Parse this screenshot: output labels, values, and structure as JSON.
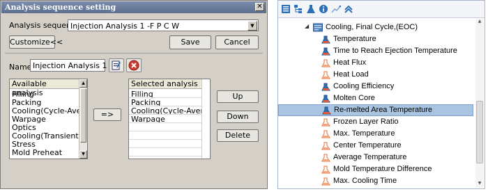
{
  "dialog": {
    "title": "Analysis sequence setting",
    "close_glyph": "✕",
    "sequence_label": "Analysis sequence:",
    "sequence_value": "Injection Analysis 1 -F P C W",
    "customize_label": "Customize<<",
    "save_label": "Save",
    "cancel_label": "Cancel",
    "name_label": "Name:",
    "name_value": "Injection Analysis 1",
    "available": {
      "header": "Available analysis",
      "items": [
        "Filling",
        "Packing",
        "Cooling(Cycle-Avera...",
        "Warpage",
        "Optics",
        "Cooling(Transient)",
        "Stress",
        "Mold Preheat"
      ]
    },
    "move_label": "=>",
    "selected": {
      "header": "Selected analysis",
      "items": [
        "Filling",
        "Packing",
        "Cooling(Cycle-Average)",
        "Warpage"
      ]
    },
    "up_label": "Up",
    "down_label": "Down",
    "delete_label": "Delete"
  },
  "tree": {
    "toolbar_icons": [
      "list-icon",
      "tree-structure-icon",
      "flask-icon",
      "info-icon",
      "chart-icon",
      "collapse-icon"
    ],
    "parent": {
      "expander": "◢",
      "label": "Cooling, Final Cycle,(EOC)",
      "icon": "folder-chart-icon"
    },
    "items": [
      {
        "label": "Temperature",
        "icon": "result-solid-icon"
      },
      {
        "label": "Time to Reach Ejection Temperature",
        "icon": "result-solid-icon"
      },
      {
        "label": "Heat Flux",
        "icon": "result-outline-icon"
      },
      {
        "label": "Heat Load",
        "icon": "result-outline-icon"
      },
      {
        "label": "Cooling Efficiency",
        "icon": "result-solid-icon"
      },
      {
        "label": "Molten Core",
        "icon": "result-solid-icon"
      },
      {
        "label": "Re-melted Area Temperature",
        "icon": "result-solid-icon",
        "selected": true
      },
      {
        "label": "Frozen Layer Ratio",
        "icon": "result-outline-icon"
      },
      {
        "label": "Max. Temperature",
        "icon": "result-outline-icon"
      },
      {
        "label": "Center Temperature",
        "icon": "result-outline-icon"
      },
      {
        "label": "Average Temperature",
        "icon": "result-outline-icon"
      },
      {
        "label": "Mold Temperature Difference",
        "icon": "result-outline-icon"
      },
      {
        "label": "Max. Cooling Time",
        "icon": "result-outline-icon"
      }
    ],
    "colors": {
      "selected_bg": "#a8c4e0",
      "accent": "#2e6fb5"
    }
  }
}
